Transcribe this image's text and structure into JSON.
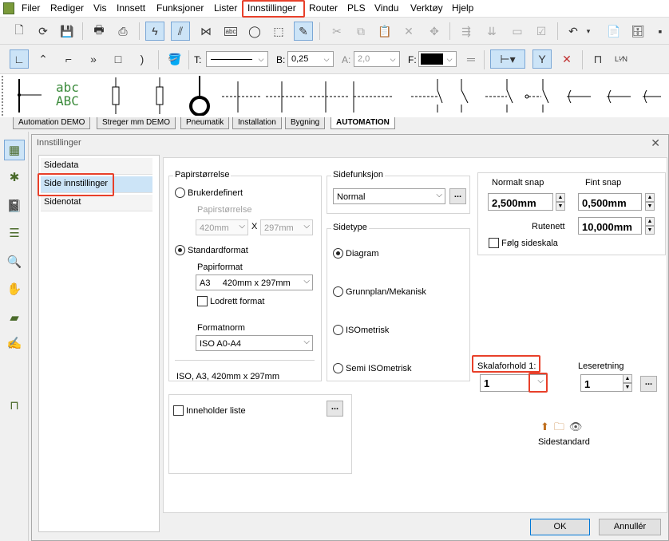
{
  "menu": [
    "Filer",
    "Rediger",
    "Vis",
    "Innsett",
    "Funksjoner",
    "Lister",
    "Innstillinger",
    "Router",
    "PLS",
    "Vindu",
    "Verktøy",
    "Hjelp"
  ],
  "format_toolbar": {
    "t_label": "T:",
    "b_label": "B:",
    "b_value": "0,25",
    "a_label": "A:",
    "a_value": "2,0",
    "f_label": "F:"
  },
  "palette_text": {
    "line1": "abc",
    "line2": "ABC"
  },
  "tabs": [
    "Automation DEMO",
    "Streger mm DEMO",
    "Pneumatik",
    "Installation",
    "Bygning",
    "AUTOMATION"
  ],
  "dialog": {
    "title": "Innstillinger",
    "nav": [
      "Sidedata",
      "Side innstillinger",
      "Sidenotat"
    ],
    "papir": {
      "title": "Papirstørrelse",
      "brukerdefinert": "Brukerdefinert",
      "papirstorrelse_label": "Papirstørrelse",
      "width": "420mm",
      "x": "X",
      "height": "297mm",
      "standardformat": "Standardformat",
      "papirformat_label": "Papirformat",
      "papirformat_value": "A3     420mm x 297mm",
      "lodrett": "Lodrett format",
      "formatnorm_label": "Formatnorm",
      "formatnorm_value": "ISO A0-A4",
      "summary": "ISO, A3, 420mm x 297mm"
    },
    "sidefunksjon": {
      "title": "Sidefunksjon",
      "value": "Normal",
      "more": "..."
    },
    "sidetype": {
      "title": "Sidetype",
      "options": [
        "Diagram",
        "Grunnplan/Mekanisk",
        "ISOmetrisk",
        "Semi ISOmetrisk"
      ]
    },
    "snap": {
      "normalt_label": "Normalt snap",
      "normalt_value": "2,500mm",
      "fint_label": "Fint snap",
      "fint_value": "0,500mm",
      "rutenett_label": "Rutenett",
      "rutenett_value": "10,000mm",
      "folg": "Følg sideskala"
    },
    "skala": {
      "label": "Skalaforhold 1:",
      "value": "1"
    },
    "leseretning": {
      "label": "Leseretning",
      "value": "1",
      "more": "..."
    },
    "inneholder": {
      "label": "Inneholder liste",
      "more": "..."
    },
    "sidestandard": "Sidestandard",
    "ok": "OK",
    "cancel": "Annullér"
  },
  "colors": {
    "highlight": "#e8402a",
    "selection": "#cce4f7",
    "icon_green": "#4a6a2a"
  }
}
